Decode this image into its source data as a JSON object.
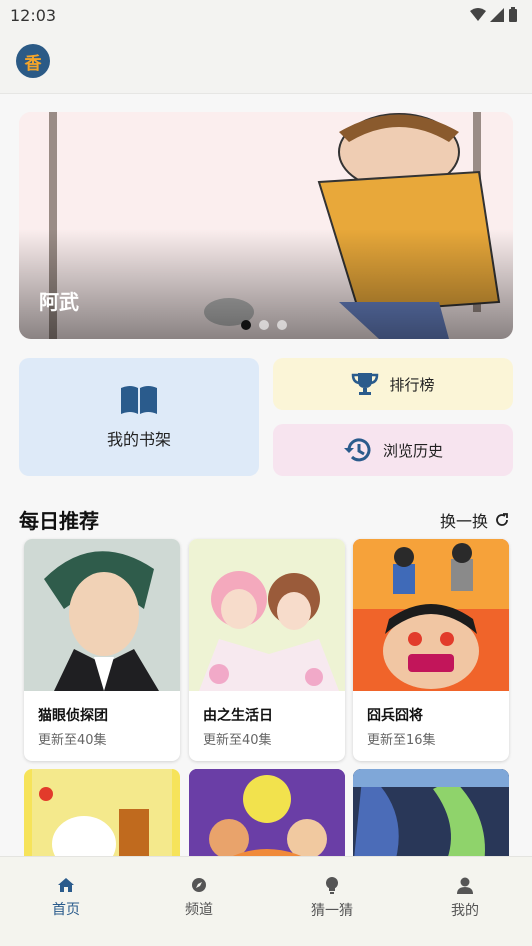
{
  "status_bar": {
    "time": "12:03"
  },
  "banner": {
    "title": "阿武",
    "dots": 3,
    "active_dot": 1
  },
  "quick_actions": {
    "shelf_label": "我的书架",
    "rank_label": "排行榜",
    "history_label": "浏览历史"
  },
  "section": {
    "title": "每日推荐",
    "refresh_label": "换一换"
  },
  "recommendations": [
    {
      "title": "猫眼侦探团",
      "update": "更新至40集"
    },
    {
      "title": "由之生活日",
      "update": "更新至40集"
    },
    {
      "title": "囧兵囧将",
      "update": "更新至16集"
    }
  ],
  "bottom_nav": [
    {
      "label": "首页",
      "icon": "home-icon"
    },
    {
      "label": "频道",
      "icon": "compass-icon"
    },
    {
      "label": "猜一猜",
      "icon": "bulb-icon"
    },
    {
      "label": "我的",
      "icon": "person-icon"
    }
  ],
  "colors": {
    "primary": "#2a5b8c",
    "shelf_bg": "#deeaf8",
    "rank_bg": "#fbf5d7",
    "history_bg": "#f7e4ef"
  }
}
